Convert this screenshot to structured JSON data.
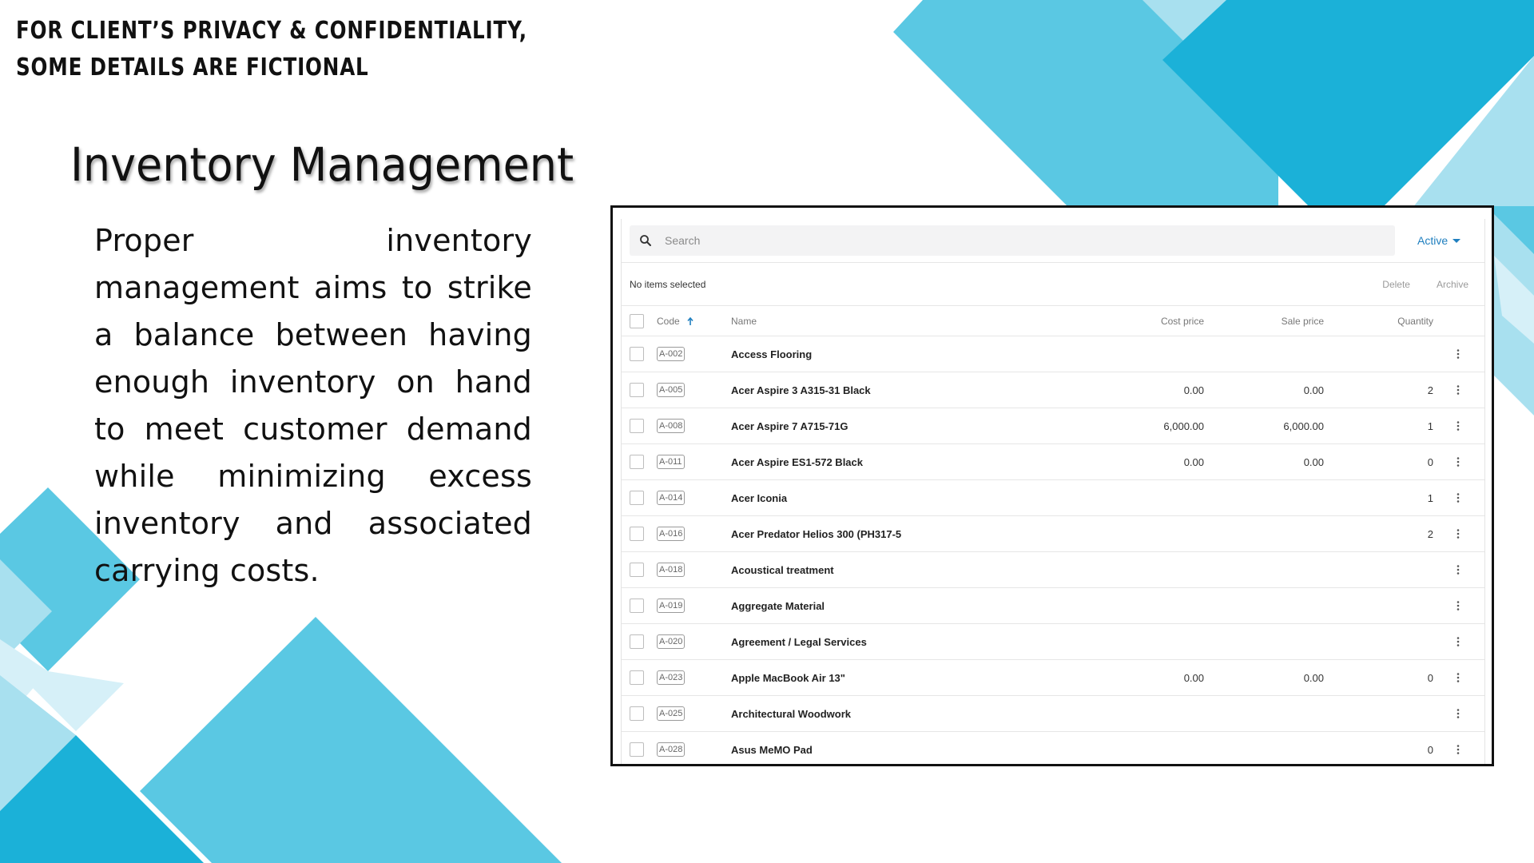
{
  "slide": {
    "notice_lines": [
      "FOR CLIENT’S PRIVACY & CONFIDENTIALITY,",
      "SOME DETAILS ARE FICTIONAL"
    ],
    "title": "Inventory Management",
    "body": "Proper inventory management aims to strike a balance between having enough inventory on hand to meet customer demand while minimizing excess inventory and associated carrying costs."
  },
  "colors": {
    "accent_dark": "#1bb1d8",
    "accent_mid": "#5ac8e3",
    "accent_light": "#a8e0ef",
    "accent_pale": "#d6f0f8",
    "link": "#1f7fbf"
  },
  "app": {
    "search": {
      "placeholder": "Search",
      "icon": "search-icon"
    },
    "filter": {
      "label": "Active",
      "icon": "caret-down-icon"
    },
    "actionbar": {
      "status": "No items selected",
      "delete_label": "Delete",
      "archive_label": "Archive"
    },
    "columns": {
      "code": "Code",
      "name": "Name",
      "cost": "Cost price",
      "sale": "Sale price",
      "qty": "Quantity"
    },
    "rows": [
      {
        "code": "A-002",
        "name": "Access Flooring",
        "cost": "",
        "sale": "",
        "qty": ""
      },
      {
        "code": "A-005",
        "name": "Acer Aspire 3 A315-31 Black",
        "cost": "0.00",
        "sale": "0.00",
        "qty": "2"
      },
      {
        "code": "A-008",
        "name": "Acer Aspire 7 A715-71G",
        "cost": "6,000.00",
        "sale": "6,000.00",
        "qty": "1"
      },
      {
        "code": "A-011",
        "name": "Acer Aspire ES1-572 Black",
        "cost": "0.00",
        "sale": "0.00",
        "qty": "0"
      },
      {
        "code": "A-014",
        "name": "Acer Iconia",
        "cost": "",
        "sale": "",
        "qty": "1"
      },
      {
        "code": "A-016",
        "name": "Acer Predator Helios 300 (PH317-5",
        "cost": "",
        "sale": "",
        "qty": "2"
      },
      {
        "code": "A-018",
        "name": "Acoustical treatment",
        "cost": "",
        "sale": "",
        "qty": ""
      },
      {
        "code": "A-019",
        "name": "Aggregate Material",
        "cost": "",
        "sale": "",
        "qty": ""
      },
      {
        "code": "A-020",
        "name": "Agreement / Legal Services",
        "cost": "",
        "sale": "",
        "qty": ""
      },
      {
        "code": "A-023",
        "name": "Apple MacBook Air 13\"",
        "cost": "0.00",
        "sale": "0.00",
        "qty": "0"
      },
      {
        "code": "A-025",
        "name": "Architectural Woodwork",
        "cost": "",
        "sale": "",
        "qty": ""
      },
      {
        "code": "A-028",
        "name": "Asus MeMO Pad",
        "cost": "",
        "sale": "",
        "qty": "0"
      }
    ]
  }
}
